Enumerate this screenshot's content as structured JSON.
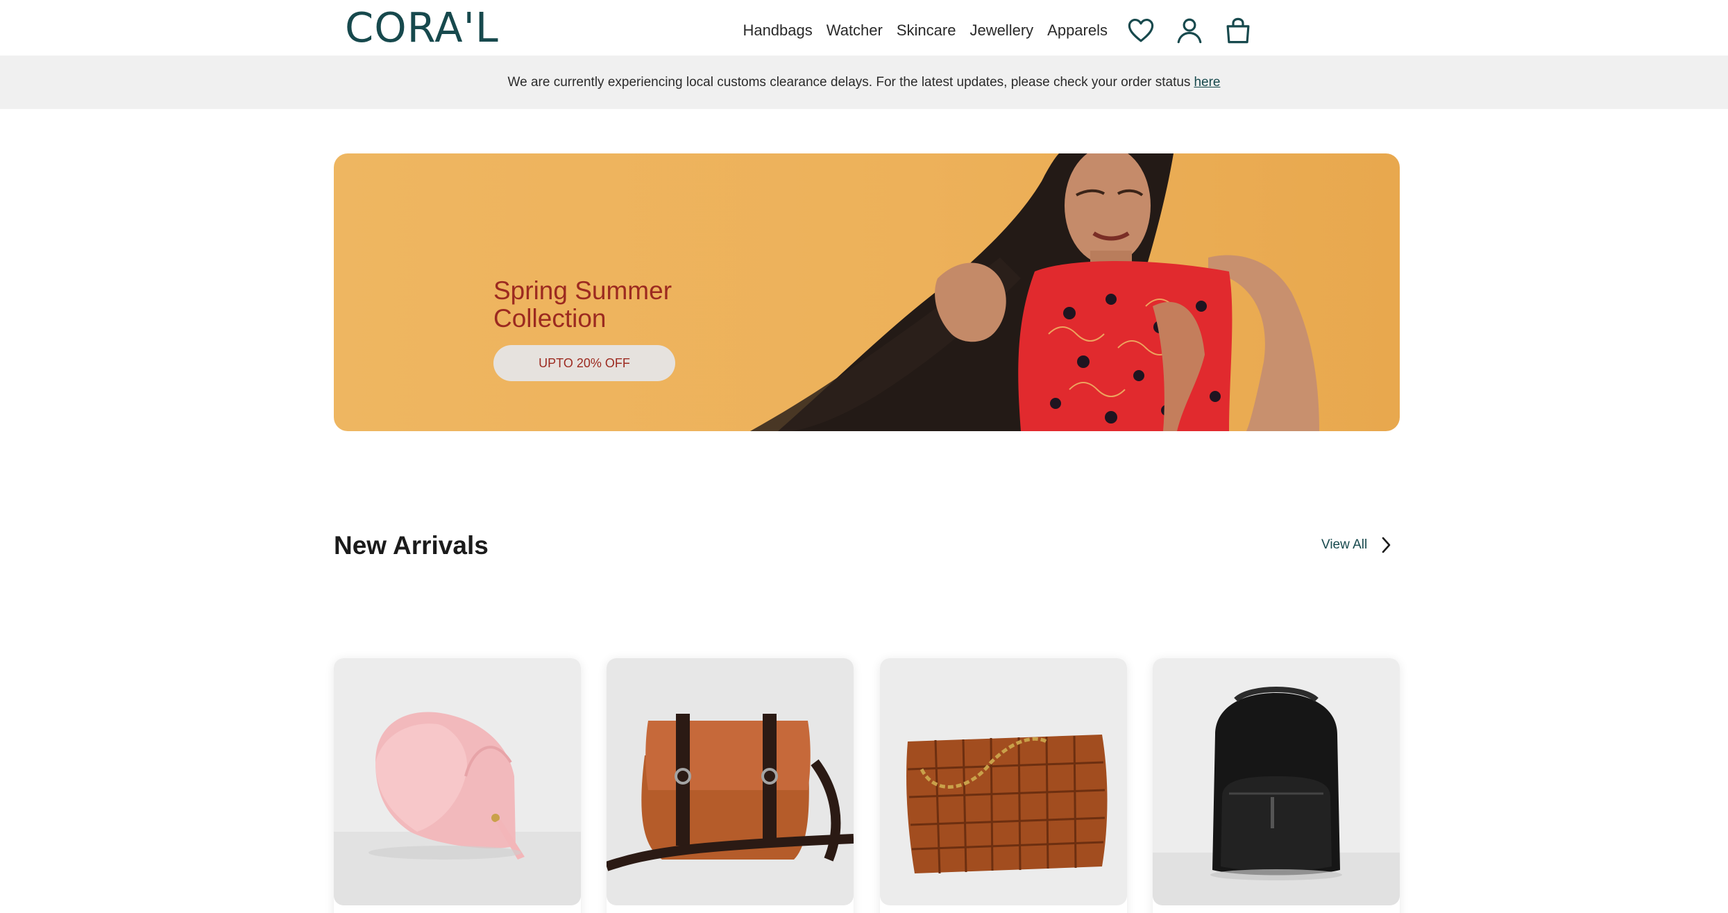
{
  "brand": {
    "logo_text": "CORA'L",
    "color": "#17494d"
  },
  "nav": {
    "links": [
      {
        "label": "Handbags"
      },
      {
        "label": "Watcher"
      },
      {
        "label": "Skincare"
      },
      {
        "label": "Jewellery"
      },
      {
        "label": "Apparels"
      }
    ],
    "icons": [
      "heart-icon",
      "user-icon",
      "shopping-bag-icon"
    ]
  },
  "announcement": {
    "text": "We are currently experiencing local customs clearance delays. For the latest updates, please check your order status",
    "link_label": "here"
  },
  "hero": {
    "title": "Spring Summer Collection",
    "button_label": "UPTO 20% OFF",
    "background_color": "#edb15a",
    "accent_color": "#9c2a20"
  },
  "new_arrivals": {
    "title": "New Arrivals",
    "view_all_label": "View All",
    "products": [
      {
        "image": "pink-saddle-bag"
      },
      {
        "image": "tan-leather-messenger-bag"
      },
      {
        "image": "brown-woven-chain-tote"
      },
      {
        "image": "black-leather-backpack"
      }
    ]
  }
}
